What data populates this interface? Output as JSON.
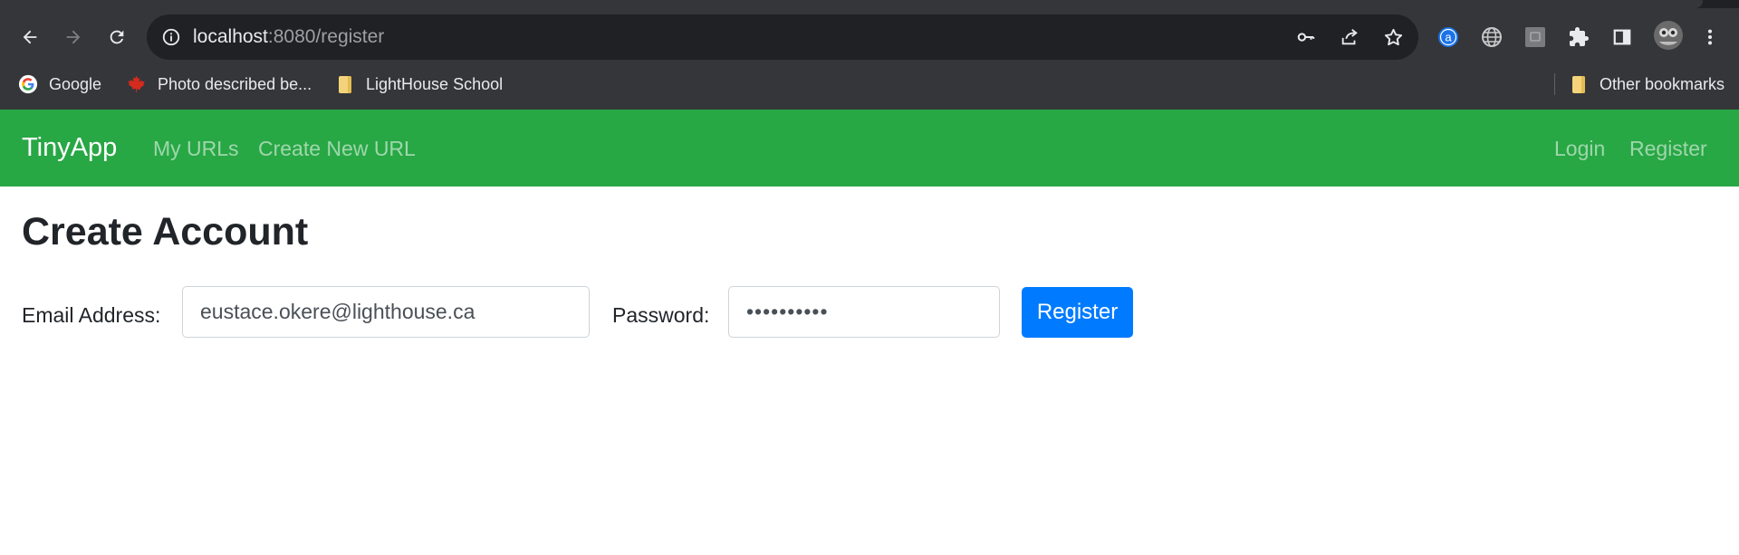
{
  "browser": {
    "url_host": "localhost",
    "url_rest": ":8080/register",
    "bookmarks": [
      {
        "label": "Google"
      },
      {
        "label": "Photo described be..."
      },
      {
        "label": "LightHouse School"
      }
    ],
    "other_bookmarks": "Other bookmarks",
    "extension_letter": "a"
  },
  "navbar": {
    "brand": "TinyApp",
    "links": [
      "My URLs",
      "Create New URL"
    ],
    "right_links": [
      "Login",
      "Register"
    ],
    "color": "#28a745"
  },
  "form": {
    "title": "Create Account",
    "email_label": "Email Address:",
    "email_value": "eustace.okere@lighthouse.ca",
    "password_label": "Password:",
    "password_value": "••••••••••",
    "submit_label": "Register",
    "submit_color": "#007bff"
  }
}
